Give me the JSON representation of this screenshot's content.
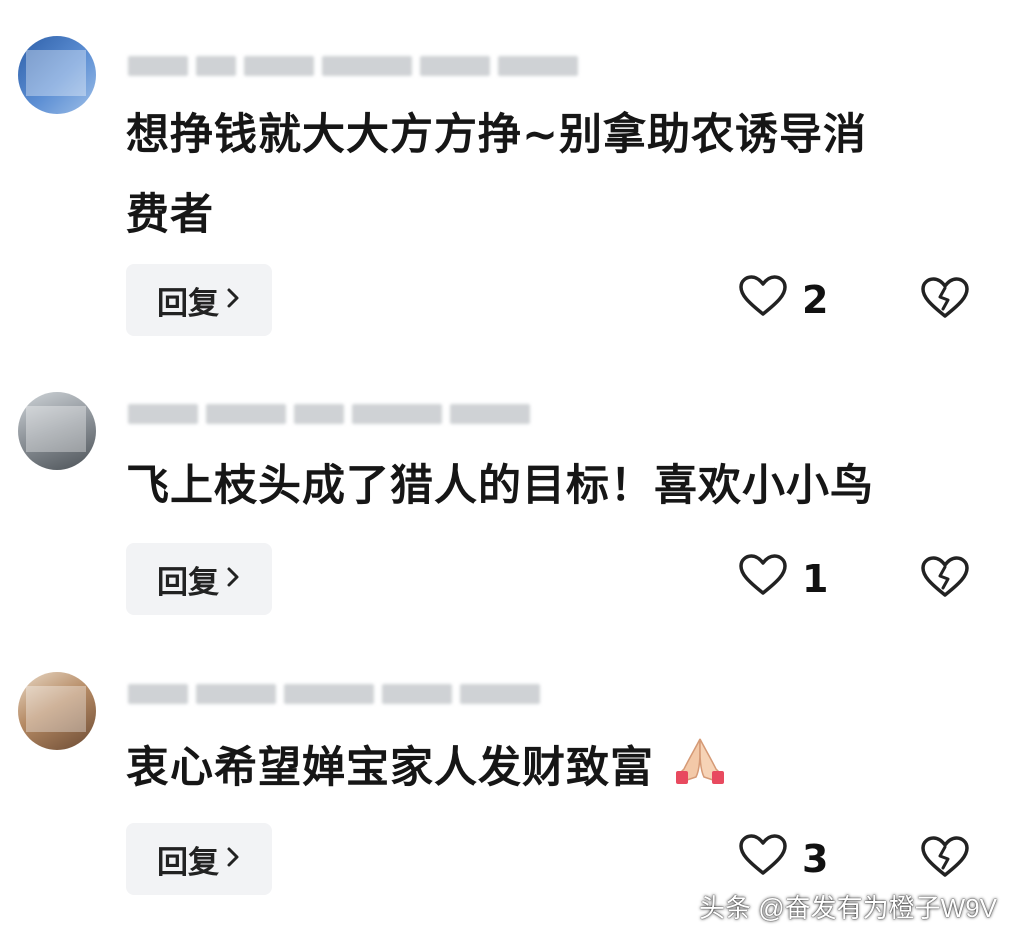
{
  "comments": [
    {
      "text_lines": [
        "想挣钱就大大方方挣~别拿助农诱导消",
        "费者"
      ],
      "reply_label": "回复",
      "like_count": "2"
    },
    {
      "text_lines": [
        "飞上枝头成了猎人的目标！喜欢小小鸟"
      ],
      "reply_label": "回复",
      "like_count": "1"
    },
    {
      "text_lines": [
        "衷心希望婵宝家人发财致富"
      ],
      "reply_label": "回复",
      "like_count": "3"
    }
  ],
  "watermark": "头条 @奋发有为橙子W9V",
  "colors": {
    "reply_bg": "#f2f3f5",
    "text": "#161616",
    "icon_stroke": "#222222"
  },
  "icons": {
    "like": "heart-outline-icon",
    "dislike": "broken-heart-icon",
    "reply_chevron": "chevron-right-icon",
    "emoji": "folded-hands-emoji"
  }
}
